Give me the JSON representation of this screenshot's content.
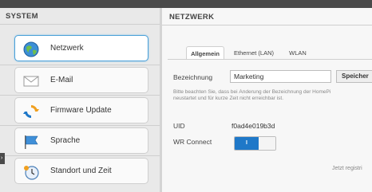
{
  "sidebar": {
    "title": "SYSTEM",
    "items": [
      {
        "label": "Netzwerk",
        "icon": "globe-icon",
        "active": true
      },
      {
        "label": "E-Mail",
        "icon": "envelope-icon",
        "active": false
      },
      {
        "label": "Firmware Update",
        "icon": "refresh-icon",
        "active": false
      },
      {
        "label": "Sprache",
        "icon": "flag-icon",
        "active": false
      },
      {
        "label": "Standort und Zeit",
        "icon": "clock-icon",
        "active": false
      }
    ]
  },
  "main": {
    "title": "NETZWERK",
    "tabs": [
      {
        "label": "Allgemein",
        "active": true
      },
      {
        "label": "Ethernet (LAN)",
        "active": false
      },
      {
        "label": "WLAN",
        "active": false
      }
    ],
    "bezeichnung": {
      "label": "Bezeichnung",
      "value": "Marketing",
      "button": "Speicher"
    },
    "hint_line1": "Bitte beachten Sie, dass bei Änderung der Bezeichnung der HomePi",
    "hint_line2": "neustartet und für kurze Zeit nicht erreichbar ist.",
    "uid": {
      "label": "UID",
      "value": "f0ad4e019b3d"
    },
    "wr_connect": {
      "label": "WR Connect",
      "toggle_text": "I",
      "state": "on"
    },
    "footer": "Jetzt registri"
  },
  "colors": {
    "accent": "#1f78c8",
    "active_border": "#4aa0d8"
  }
}
